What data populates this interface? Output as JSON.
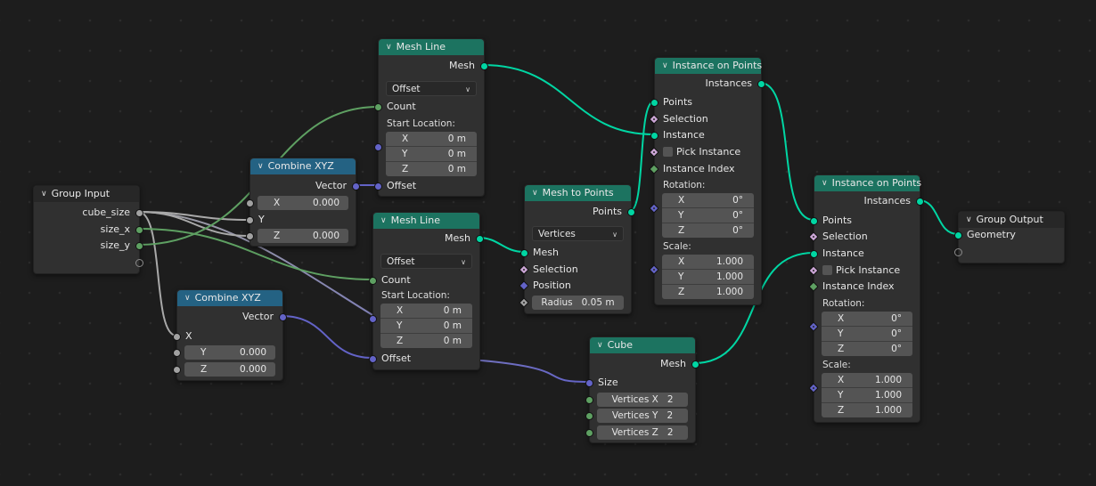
{
  "editor": "Geometry Node Editor",
  "colors": {
    "background": "#1d1d1d",
    "geometry_header": "#1c7360",
    "converter_header": "#246283",
    "geometry_socket": "#00d6a3",
    "integer_socket": "#5ea062",
    "vector_socket": "#6363c7",
    "float_socket": "#a1a1a1",
    "boolean_socket": "#cca6d6"
  },
  "nodes": {
    "group_input": {
      "title": "Group Input",
      "outputs": [
        "cube_size",
        "size_x",
        "size_y"
      ]
    },
    "combine_xyz_1": {
      "title": "Combine XYZ",
      "output": "Vector",
      "x_label": "X",
      "x_value": "0.000",
      "y_label": "Y",
      "z_label": "Z",
      "z_value": "0.000"
    },
    "combine_xyz_2": {
      "title": "Combine XYZ",
      "output": "Vector",
      "x_label": "X",
      "y_label": "Y",
      "y_value": "0.000",
      "z_label": "Z",
      "z_value": "0.000"
    },
    "mesh_line_1": {
      "title": "Mesh Line",
      "output": "Mesh",
      "mode": "Offset",
      "count_label": "Count",
      "start_location_label": "Start Location:",
      "start_location": [
        {
          "axis": "X",
          "value": "0 m"
        },
        {
          "axis": "Y",
          "value": "0 m"
        },
        {
          "axis": "Z",
          "value": "0 m"
        }
      ],
      "offset_label": "Offset"
    },
    "mesh_line_2": {
      "title": "Mesh Line",
      "output": "Mesh",
      "mode": "Offset",
      "count_label": "Count",
      "start_location_label": "Start Location:",
      "start_location": [
        {
          "axis": "X",
          "value": "0 m"
        },
        {
          "axis": "Y",
          "value": "0 m"
        },
        {
          "axis": "Z",
          "value": "0 m"
        }
      ],
      "offset_label": "Offset"
    },
    "mesh_to_points": {
      "title": "Mesh to Points",
      "output": "Points",
      "mode": "Vertices",
      "mesh_label": "Mesh",
      "selection_label": "Selection",
      "position_label": "Position",
      "radius_label": "Radius",
      "radius_value": "0.05 m"
    },
    "instance_on_points_1": {
      "title": "Instance on Points",
      "output": "Instances",
      "points_label": "Points",
      "selection_label": "Selection",
      "instance_label": "Instance",
      "pick_instance_label": "Pick Instance",
      "instance_index_label": "Instance Index",
      "rotation_label": "Rotation:",
      "rotation": [
        {
          "axis": "X",
          "value": "0°"
        },
        {
          "axis": "Y",
          "value": "0°"
        },
        {
          "axis": "Z",
          "value": "0°"
        }
      ],
      "scale_label": "Scale:",
      "scale": [
        {
          "axis": "X",
          "value": "1.000"
        },
        {
          "axis": "Y",
          "value": "1.000"
        },
        {
          "axis": "Z",
          "value": "1.000"
        }
      ]
    },
    "instance_on_points_2": {
      "title": "Instance on Points",
      "output": "Instances",
      "points_label": "Points",
      "selection_label": "Selection",
      "instance_label": "Instance",
      "pick_instance_label": "Pick Instance",
      "instance_index_label": "Instance Index",
      "rotation_label": "Rotation:",
      "rotation": [
        {
          "axis": "X",
          "value": "0°"
        },
        {
          "axis": "Y",
          "value": "0°"
        },
        {
          "axis": "Z",
          "value": "0°"
        }
      ],
      "scale_label": "Scale:",
      "scale": [
        {
          "axis": "X",
          "value": "1.000"
        },
        {
          "axis": "Y",
          "value": "1.000"
        },
        {
          "axis": "Z",
          "value": "1.000"
        }
      ]
    },
    "cube": {
      "title": "Cube",
      "output": "Mesh",
      "size_label": "Size",
      "vertices": [
        {
          "label": "Vertices X",
          "value": "2"
        },
        {
          "label": "Vertices Y",
          "value": "2"
        },
        {
          "label": "Vertices Z",
          "value": "2"
        }
      ]
    },
    "group_output": {
      "title": "Group Output",
      "input": "Geometry"
    }
  },
  "links": [
    {
      "from": "group_input.cube_size",
      "to": "combine_xyz_1.Y",
      "type": "float"
    },
    {
      "from": "group_input.cube_size",
      "to": "combine_xyz_1.Z",
      "type": "float"
    },
    {
      "from": "group_input.cube_size",
      "to": "combine_xyz_2.X",
      "type": "float"
    },
    {
      "from": "group_input.cube_size",
      "to": "cube.Size",
      "type": "float-to-vector"
    },
    {
      "from": "group_input.size_x",
      "to": "mesh_line_2.Count",
      "type": "int"
    },
    {
      "from": "group_input.size_y",
      "to": "mesh_line_1.Count",
      "type": "int"
    },
    {
      "from": "combine_xyz_1.Vector",
      "to": "mesh_line_1.Offset",
      "type": "vector"
    },
    {
      "from": "combine_xyz_2.Vector",
      "to": "mesh_line_2.Offset",
      "type": "vector"
    },
    {
      "from": "mesh_line_1.Mesh",
      "to": "instance_on_points_1.Instance",
      "type": "geometry"
    },
    {
      "from": "mesh_line_2.Mesh",
      "to": "mesh_to_points.Mesh",
      "type": "geometry"
    },
    {
      "from": "mesh_to_points.Points",
      "to": "instance_on_points_1.Points",
      "type": "geometry"
    },
    {
      "from": "instance_on_points_1.Instances",
      "to": "instance_on_points_2.Points",
      "type": "geometry"
    },
    {
      "from": "cube.Mesh",
      "to": "instance_on_points_2.Instance",
      "type": "geometry"
    },
    {
      "from": "instance_on_points_2.Instances",
      "to": "group_output.Geometry",
      "type": "geometry"
    }
  ]
}
